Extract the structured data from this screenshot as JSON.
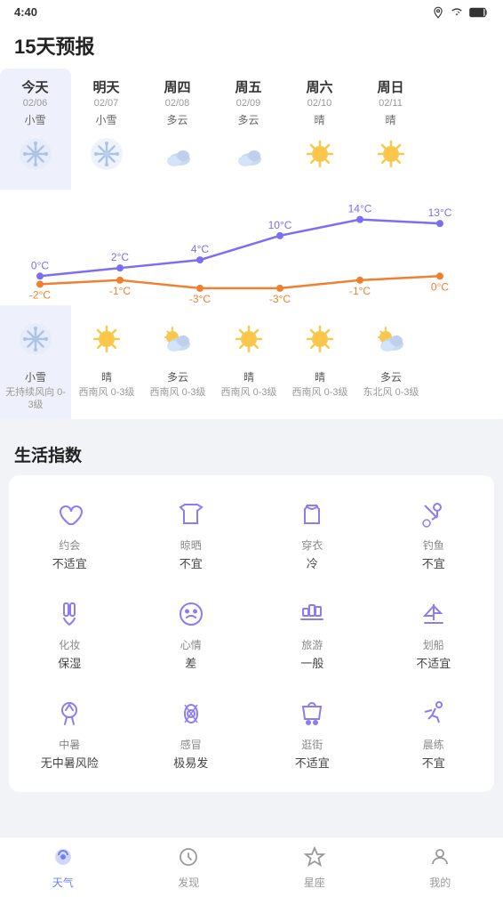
{
  "statusBar": {
    "time": "4:40",
    "icons": [
      "location",
      "wifi",
      "battery"
    ]
  },
  "pageTitle": "15天预报",
  "forecast": {
    "days": [
      {
        "name": "今天",
        "date": "02/06",
        "conditionTop": "小雪",
        "iconTop": "snow",
        "highTemp": "0°C",
        "lowTemp": "-2°C",
        "iconBottom": "snow",
        "conditionBottom": "小雪",
        "wind": "无持续风向\n0-3级",
        "today": true
      },
      {
        "name": "明天",
        "date": "02/07",
        "conditionTop": "小雪",
        "iconTop": "snow_light",
        "highTemp": "2°C",
        "lowTemp": "-1°C",
        "iconBottom": "sunny",
        "conditionBottom": "晴",
        "wind": "西南风\n0-3级",
        "today": false
      },
      {
        "name": "周四",
        "date": "02/08",
        "conditionTop": "多云",
        "iconTop": "cloudy",
        "highTemp": "4°C",
        "lowTemp": "-3°C",
        "iconBottom": "partcloudy",
        "conditionBottom": "多云",
        "wind": "西南风\n0-3级",
        "today": false
      },
      {
        "name": "周五",
        "date": "02/09",
        "conditionTop": "多云",
        "iconTop": "cloudy",
        "highTemp": "10°C",
        "lowTemp": "-3°C",
        "iconBottom": "sunny",
        "conditionBottom": "晴",
        "wind": "西南风\n0-3级",
        "today": false
      },
      {
        "name": "周六",
        "date": "02/10",
        "conditionTop": "晴",
        "iconTop": "sunny",
        "highTemp": "14°C",
        "lowTemp": "-1°C",
        "iconBottom": "sunny",
        "conditionBottom": "晴",
        "wind": "西南风\n0-3级",
        "today": false
      },
      {
        "name": "周日",
        "date": "02/11",
        "conditionTop": "晴",
        "iconTop": "sunny",
        "highTemp": "13°C",
        "lowTemp": "0°C",
        "iconBottom": "partcloudy",
        "conditionBottom": "多云",
        "wind": "东北风\n0-3级",
        "today": false
      }
    ],
    "chartColors": {
      "high": "#7b6ef6",
      "low": "#f08030"
    }
  },
  "lifeIndices": {
    "sectionTitle": "生活指数",
    "items": [
      {
        "icon": "heart",
        "name": "约会",
        "value": "不适宜"
      },
      {
        "icon": "tshirt",
        "name": "晾晒",
        "value": "不宜"
      },
      {
        "icon": "clothes",
        "name": "穿衣",
        "value": "冷"
      },
      {
        "icon": "fishing",
        "name": "钓鱼",
        "value": "不宜"
      },
      {
        "icon": "makeup",
        "name": "化妆",
        "value": "保湿"
      },
      {
        "icon": "mood",
        "name": "心情",
        "value": "差"
      },
      {
        "icon": "travel",
        "name": "旅游",
        "value": "一般"
      },
      {
        "icon": "sailing",
        "name": "划船",
        "value": "不适宜"
      },
      {
        "icon": "sun_stroke",
        "name": "中暑",
        "value": "无中暑风险"
      },
      {
        "icon": "cold",
        "name": "感冒",
        "value": "极易发"
      },
      {
        "icon": "shopping",
        "name": "逛街",
        "value": "不适宜"
      },
      {
        "icon": "exercise",
        "name": "晨练",
        "value": "不宜"
      }
    ]
  },
  "bottomNav": {
    "items": [
      {
        "label": "天气",
        "icon": "weather",
        "active": true
      },
      {
        "label": "发现",
        "icon": "discover",
        "active": false
      },
      {
        "label": "星座",
        "icon": "star",
        "active": false
      },
      {
        "label": "我的",
        "icon": "user",
        "active": false
      }
    ]
  }
}
